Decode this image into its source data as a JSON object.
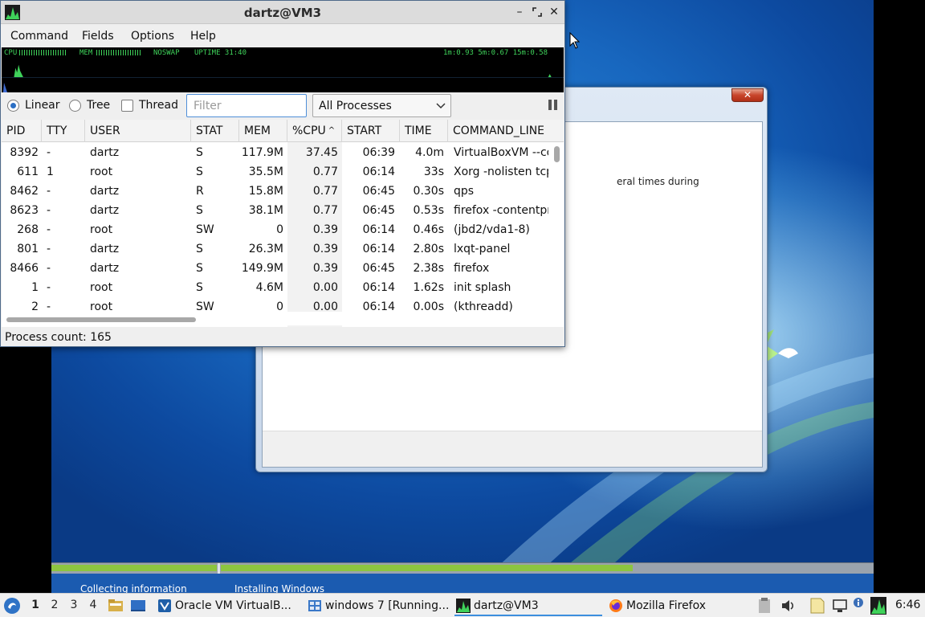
{
  "colors": {
    "accent": "#2b6fc4",
    "graph_green": "#3fd25a",
    "progress_green": "#8cc540",
    "taskbar_bg": "#f0f0f0"
  },
  "window": {
    "title": "dartz@VM3",
    "min_icon": "minimize-icon",
    "max_icon": "maximize-icon",
    "close_icon": "close-icon"
  },
  "menu": [
    "Command",
    "Fields",
    "Options",
    "Help"
  ],
  "graphs": {
    "cpu_label": "CPU",
    "mem_label": "MEM",
    "swap_label": "NOSWAP",
    "uptime_label": "UPTIME 31:40",
    "load_label": "1m:0.93 5m:0.67 15m:0.58"
  },
  "toolbar": {
    "linear_label": "Linear",
    "tree_label": "Tree",
    "thread_label": "Thread",
    "view_mode": "Linear",
    "thread_checked": false,
    "filter_value": "",
    "filter_placeholder": "Filter",
    "process_scope": "All Processes"
  },
  "table": {
    "columns": [
      "PID",
      "TTY",
      "USER",
      "STAT",
      "MEM",
      "%CPU",
      "START",
      "TIME",
      "COMMAND_LINE"
    ],
    "sort_column": "%CPU",
    "rows": [
      [
        "8392",
        "-",
        "dartz",
        "S",
        "117.9M",
        "37.45",
        "06:39",
        "4.0m",
        "VirtualBoxVM --co"
      ],
      [
        "611",
        "1",
        "root",
        "S",
        "35.5M",
        "0.77",
        "06:14",
        "33s",
        "Xorg -nolisten tcp"
      ],
      [
        "8462",
        "-",
        "dartz",
        "R",
        "15.8M",
        "0.77",
        "06:45",
        "0.30s",
        "qps"
      ],
      [
        "8623",
        "-",
        "dartz",
        "S",
        "38.1M",
        "0.77",
        "06:45",
        "0.53s",
        "firefox -contentpr"
      ],
      [
        "268",
        "-",
        "root",
        "SW",
        "0",
        "0.39",
        "06:14",
        "0.46s",
        "(jbd2/vda1-8)"
      ],
      [
        "801",
        "-",
        "dartz",
        "S",
        "26.3M",
        "0.39",
        "06:14",
        "2.80s",
        "lxqt-panel"
      ],
      [
        "8466",
        "-",
        "dartz",
        "S",
        "149.9M",
        "0.39",
        "06:45",
        "2.38s",
        "firefox"
      ],
      [
        "1",
        "-",
        "root",
        "S",
        "4.6M",
        "0.00",
        "06:14",
        "1.62s",
        "init splash"
      ],
      [
        "2",
        "-",
        "root",
        "SW",
        "0",
        "0.00",
        "06:14",
        "0.00s",
        "(kthreadd)"
      ]
    ]
  },
  "status": {
    "process_count": "Process count: 165"
  },
  "vm": {
    "setup_text": "eral times during",
    "step1": "Collecting information",
    "step2": "Installing Windows"
  },
  "taskbar": {
    "desktops": [
      "1",
      "2",
      "3",
      "4"
    ],
    "active_desktop": "1",
    "tasks": [
      {
        "label": "Oracle VM VirtualB...",
        "icon": "virtualbox-icon"
      },
      {
        "label": "windows 7 [Running...",
        "icon": "vm-window-icon"
      },
      {
        "label": "dartz@VM3",
        "icon": "qps-icon"
      },
      {
        "label": "Mozilla Firefox",
        "icon": "firefox-icon"
      }
    ],
    "clock": "6:46"
  }
}
